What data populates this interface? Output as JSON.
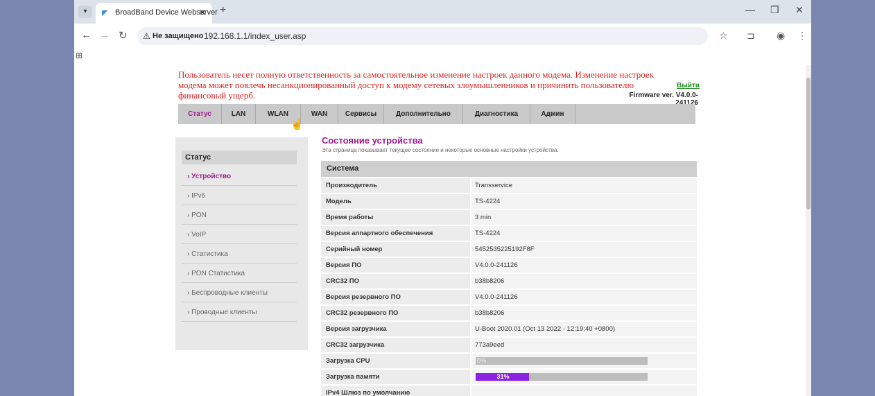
{
  "browser": {
    "tab_title": "BroadBand Device Webserver",
    "security_label": "Не защищено",
    "url": "192.168.1.1/index_user.asp"
  },
  "header": {
    "warning": "Пользователь несет полную ответственность за самостоятельное изменение настроек данного модема. Изменение настроек модема может повлечь несанкционированный доступ к модему сетевых злоумышленников и причинить пользователю финансовый ущерб.",
    "logout": "Выйти",
    "firmware": "Firmware ver. V4.0.0-241126"
  },
  "nav": {
    "items": [
      "Статус",
      "LAN",
      "WLAN",
      "WAN",
      "Сервисы",
      "Дополнительно",
      "Диагностика",
      "Админ"
    ],
    "active": "Статус"
  },
  "sidebar": {
    "title": "Статус",
    "items": [
      "Устройство",
      "IPv6",
      "PON",
      "VoIP",
      "Статистика",
      "PON Статистика",
      "Беспроводные клиенты",
      "Проводные клиенты"
    ]
  },
  "content": {
    "title": "Состояние устройства",
    "subtitle": "Эта страница показывает текущее состояние и некоторые основные настройки устройства.",
    "section": "Система",
    "rows": [
      {
        "k": "Производитель",
        "v": "Transservice"
      },
      {
        "k": "Модель",
        "v": "TS-4224"
      },
      {
        "k": "Время работы",
        "v": "3 min"
      },
      {
        "k": "Версия аппартного обеспечения",
        "v": "TS-4224"
      },
      {
        "k": "Серийный номер",
        "v": "5452535225192F8F"
      },
      {
        "k": "Версия ПО",
        "v": "V4.0.0-241126"
      },
      {
        "k": "CRC32 ПО",
        "v": "b38b8206"
      },
      {
        "k": "Версия резервного ПО",
        "v": "V4.0.0-241126"
      },
      {
        "k": "CRC32 резервного ПО",
        "v": "b38b8206"
      },
      {
        "k": "Версия загрузчика",
        "v": "U-Boot 2020.01 (Oct 13 2022 - 12:19:40 +0800)"
      },
      {
        "k": "CRC32 загрузчика",
        "v": "773a9eed"
      }
    ],
    "cpu": {
      "label": "Загрузка CPU",
      "value_text": "0%",
      "percent": 0
    },
    "mem": {
      "label": "Загрузка памяти",
      "value_text": "31%",
      "percent": 31
    },
    "last_row_label": "IPv4 Шлюз по умолчанию"
  },
  "colors": {
    "accent": "#9c1a8e",
    "warning": "#e02020",
    "bar_fill": "#8a22e0"
  }
}
